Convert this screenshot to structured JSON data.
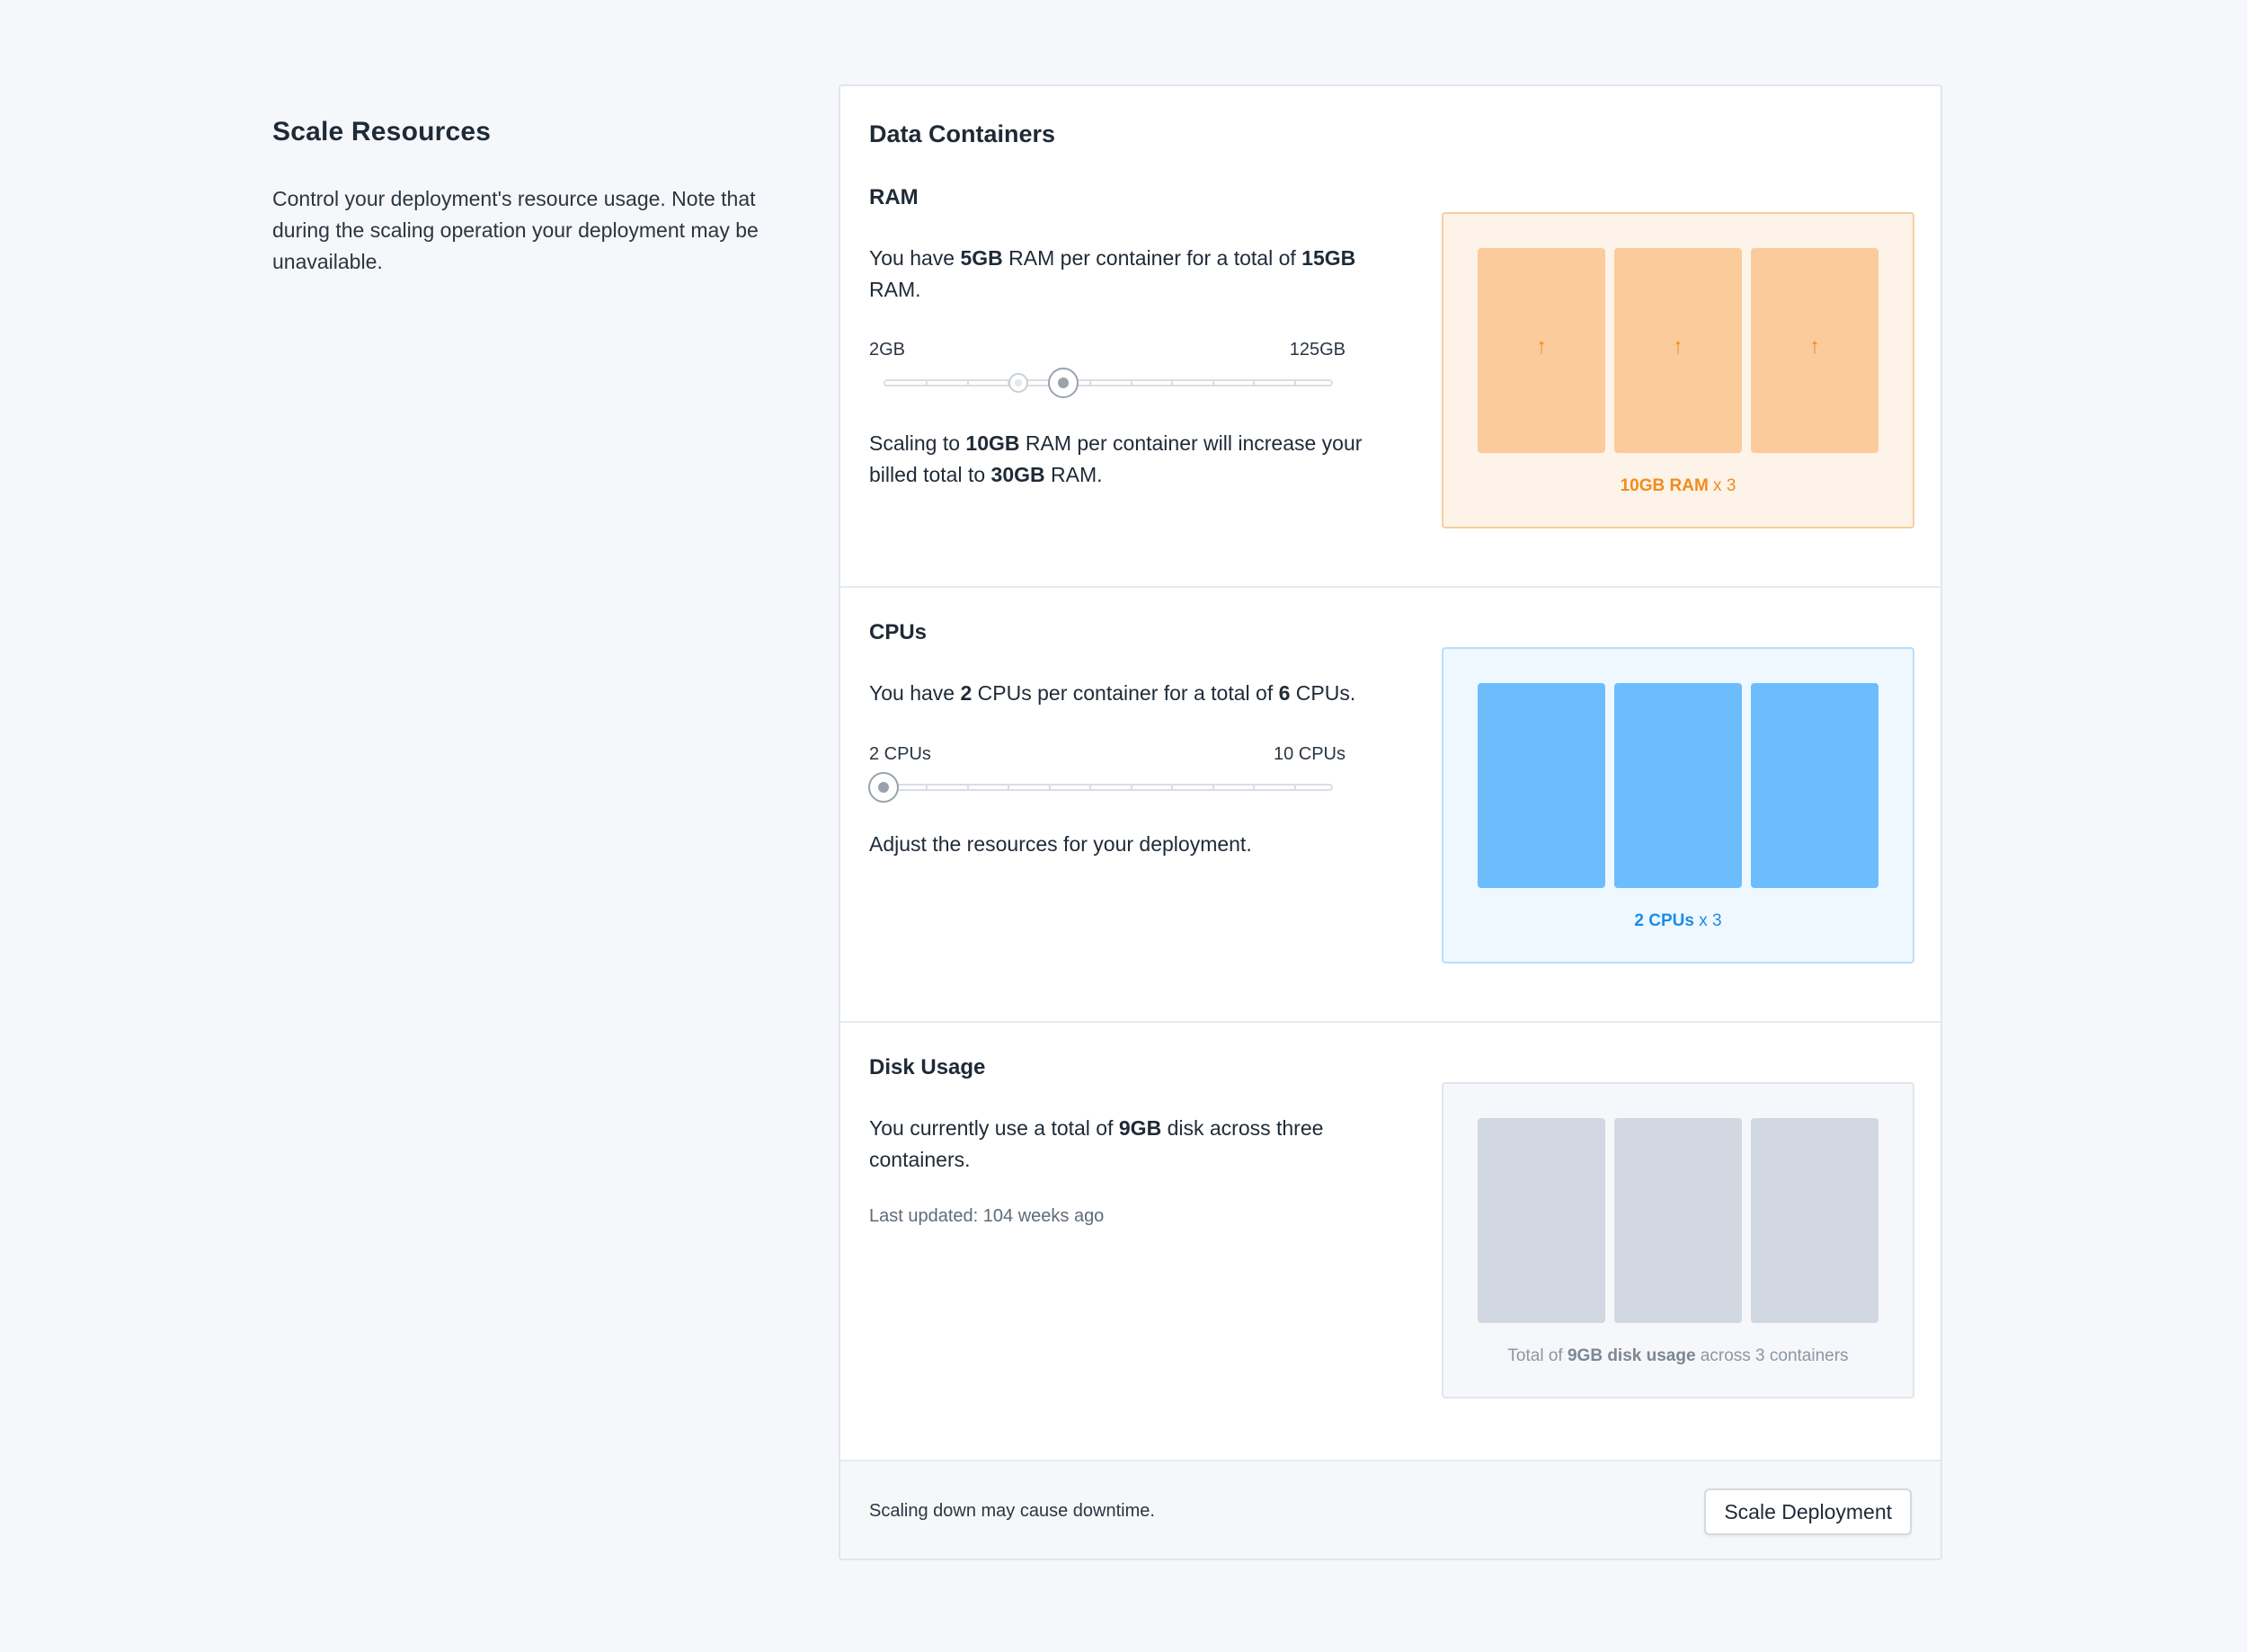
{
  "intro": {
    "title": "Scale Resources",
    "description": "Control your deployment's resource usage. Note that during the scaling operation your deployment may be unavailable."
  },
  "card": {
    "title": "Data Containers"
  },
  "ram": {
    "title": "RAM",
    "current_pre": "You have ",
    "current_per": "5GB",
    "current_mid": " RAM per container for a total of ",
    "current_total": "15GB",
    "current_post": " RAM.",
    "slider_min": "2GB",
    "slider_max": "125GB",
    "slider_current_fraction": 0.3,
    "slider_target_fraction": 0.4,
    "scale_pre": "Scaling to ",
    "scale_per": "10GB",
    "scale_mid": " RAM per container will increase your billed total to ",
    "scale_total": "30GB",
    "scale_post": " RAM.",
    "viz_label_strong": "10GB RAM",
    "viz_label_rest": " x 3",
    "arrow_icon": "arrow-up-icon",
    "accent": "#f08c1e"
  },
  "cpu": {
    "title": "CPUs",
    "current_pre": "You have ",
    "current_per": "2",
    "current_mid": " CPUs per container for a total of ",
    "current_total": "6",
    "current_post": " CPUs.",
    "slider_min": "2 CPUs",
    "slider_max": "10 CPUs",
    "slider_current_fraction": 0,
    "note": "Adjust the resources for your deployment.",
    "viz_label_strong": "2 CPUs",
    "viz_label_rest": " x 3",
    "accent": "#1b8ce6"
  },
  "disk": {
    "title": "Disk Usage",
    "current_pre": "You currently use a total of ",
    "current_total": "9GB",
    "current_post": " disk across three containers.",
    "updated": "Last updated: 104 weeks ago",
    "viz_pre": "Total of ",
    "viz_strong": "9GB disk usage",
    "viz_post": " across 3 containers"
  },
  "footer": {
    "note": "Scaling down may cause downtime.",
    "button": "Scale Deployment"
  }
}
